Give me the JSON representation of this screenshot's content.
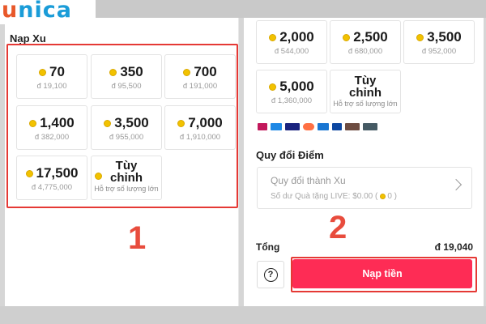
{
  "brand": {
    "logo_u": "u",
    "logo_rest": "nica"
  },
  "left": {
    "title": "Nạp Xu",
    "packages": [
      {
        "amount": "70",
        "price": "đ 19,100"
      },
      {
        "amount": "350",
        "price": "đ 95,500"
      },
      {
        "amount": "700",
        "price": "đ 191,000"
      },
      {
        "amount": "1,400",
        "price": "đ 382,000"
      },
      {
        "amount": "3,500",
        "price": "đ 955,000"
      },
      {
        "amount": "7,000",
        "price": "đ 1,910,000"
      },
      {
        "amount": "17,500",
        "price": "đ 4,775,000"
      }
    ],
    "custom": {
      "line1": "Tùy",
      "line2": "chỉnh",
      "sub": "Hỗ trợ số lượng lớn"
    }
  },
  "right": {
    "packages": [
      {
        "amount": "2,000",
        "price": "đ 544,000"
      },
      {
        "amount": "2,500",
        "price": "đ 680,000"
      },
      {
        "amount": "3,500",
        "price": "đ 952,000"
      },
      {
        "amount": "5,000",
        "price": "đ 1,360,000"
      }
    ],
    "custom": {
      "line1": "Tùy",
      "line2": "chỉnh",
      "sub": "Hỗ trợ số lượng lớn"
    },
    "payment_methods": [
      "dana",
      "DANA",
      "VISA",
      "mastercard",
      "amex",
      "diners",
      "discover",
      "zcap"
    ],
    "convert_section_title": "Quy đổi Điểm",
    "convert_title": "Quy đổi thành Xu",
    "convert_sub_before": "Số dư Quà tặng LIVE: $0.00 (",
    "convert_sub_after": "0 )",
    "total_label": "Tổng",
    "total_value": "đ 19,040",
    "pay_label": "Nạp tiền"
  },
  "annotations": {
    "step1": "1",
    "step2": "2"
  },
  "colors": {
    "accent": "#fe2c55",
    "annotation": "#e53935",
    "coin": "#f2c200"
  }
}
